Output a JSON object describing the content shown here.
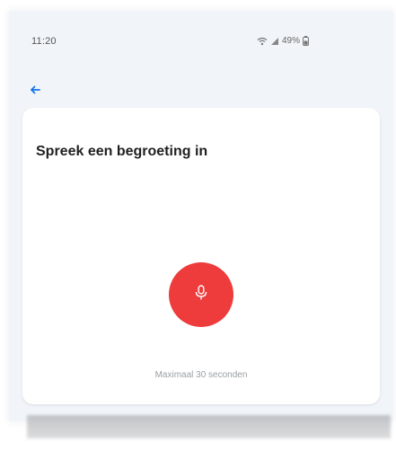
{
  "status_bar": {
    "time": "11:20",
    "battery": "49%",
    "icons": [
      "wifi-icon",
      "signal-icon",
      "battery-icon"
    ]
  },
  "nav": {
    "back_icon": "arrow-left-icon"
  },
  "card": {
    "title": "Spreek een begroeting in",
    "record_icon": "microphone-icon",
    "hint": "Maximaal 30 seconden"
  },
  "colors": {
    "screen_bg": "#f1f5f9",
    "card_bg": "#ffffff",
    "record_button": "#ee3b3b",
    "back_arrow": "#1a73e8",
    "hint_text": "#9aa0a6"
  }
}
